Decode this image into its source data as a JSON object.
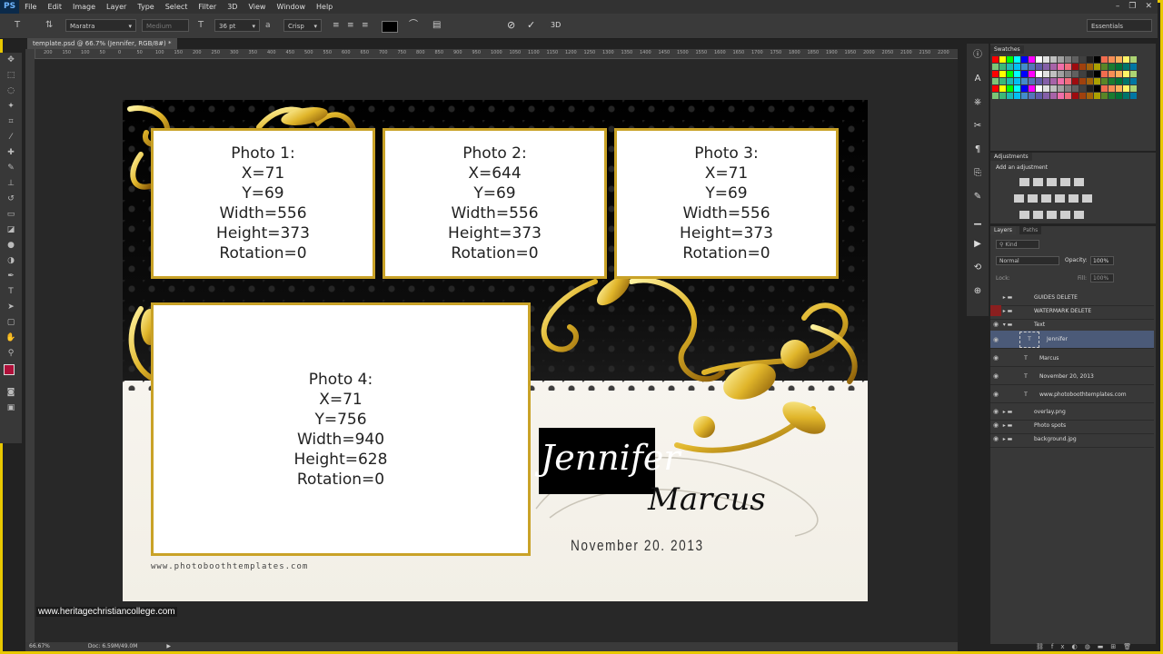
{
  "app": {
    "logo": "PS",
    "menu": [
      "File",
      "Edit",
      "Image",
      "Layer",
      "Type",
      "Select",
      "Filter",
      "3D",
      "View",
      "Window",
      "Help"
    ],
    "window_controls": [
      "–",
      "❐",
      "✕"
    ]
  },
  "options_bar": {
    "font_family": "Maratra",
    "font_style": "Medium",
    "font_size": "36 pt",
    "aa_label": "a",
    "anti_alias": "Crisp",
    "workspace": "Essentials"
  },
  "document": {
    "tab_title": "template.psd @ 66.7% (Jennifer, RGB/8#) *",
    "zoom": "66.67%",
    "doc_size": "Doc: 6.59M/49.0M"
  },
  "ruler_ticks": [
    "200",
    "150",
    "100",
    "50",
    "0",
    "50",
    "100",
    "150",
    "200",
    "250",
    "300",
    "350",
    "400",
    "450",
    "500",
    "550",
    "600",
    "650",
    "700",
    "750",
    "800",
    "850",
    "900",
    "950",
    "1000",
    "1050",
    "1100",
    "1150",
    "1200",
    "1250",
    "1300",
    "1350",
    "1400",
    "1450",
    "1500",
    "1550",
    "1600",
    "1650",
    "1700",
    "1750",
    "1800",
    "1850",
    "1900",
    "1950",
    "2000",
    "2050",
    "2100",
    "2150",
    "2200"
  ],
  "photos": [
    {
      "lines": [
        "Photo 1:",
        "X=71",
        "Y=69",
        "Width=556",
        "Height=373",
        "Rotation=0"
      ]
    },
    {
      "lines": [
        "Photo 2:",
        "X=644",
        "Y=69",
        "Width=556",
        "Height=373",
        "Rotation=0"
      ]
    },
    {
      "lines": [
        "Photo 3:",
        "X=71",
        "Y=69",
        "Width=556",
        "Height=373",
        "Rotation=0"
      ]
    },
    {
      "lines": [
        "Photo 4:",
        "X=71",
        "Y=756",
        "Width=940",
        "Height=628",
        "Rotation=0"
      ]
    }
  ],
  "design_text": {
    "name1": "Jennifer",
    "name2": "Marcus",
    "date": "November 20. 2013",
    "website": "www.photoboothtemplates.com"
  },
  "watermark": "www.heritagechristiancollege.com",
  "panels": {
    "swatches_title": "Swatches",
    "adjustments_title": "Adjustments",
    "adjustments_subtitle": "Add an adjustment",
    "layers_tab": "Layers",
    "paths_tab": "Paths",
    "kind_filter": "Kind",
    "blend_mode": "Normal",
    "opacity_label": "Opacity:",
    "opacity_value": "100%",
    "lock_label": "Lock:",
    "fill_label": "Fill:",
    "fill_value": "100%"
  },
  "layers": [
    {
      "name": "GUIDES DELETE",
      "type": "folder"
    },
    {
      "name": "WATERMARK DELETE",
      "type": "folder"
    },
    {
      "name": "Text",
      "type": "folder-open"
    },
    {
      "name": "Jennifer",
      "type": "text",
      "selected": true
    },
    {
      "name": "Marcus",
      "type": "text"
    },
    {
      "name": "November 20, 2013",
      "type": "text"
    },
    {
      "name": "www.photoboothtemplates.com",
      "type": "text"
    },
    {
      "name": "overlay.png",
      "type": "folder"
    },
    {
      "name": "Photo spots",
      "type": "folder"
    },
    {
      "name": "background.jpg",
      "type": "folder"
    }
  ],
  "colors": {
    "accent_gold": "#c9a227",
    "foreground": "#b0103a",
    "background": "#ffffff",
    "selected_layer": "#4b5a78"
  }
}
